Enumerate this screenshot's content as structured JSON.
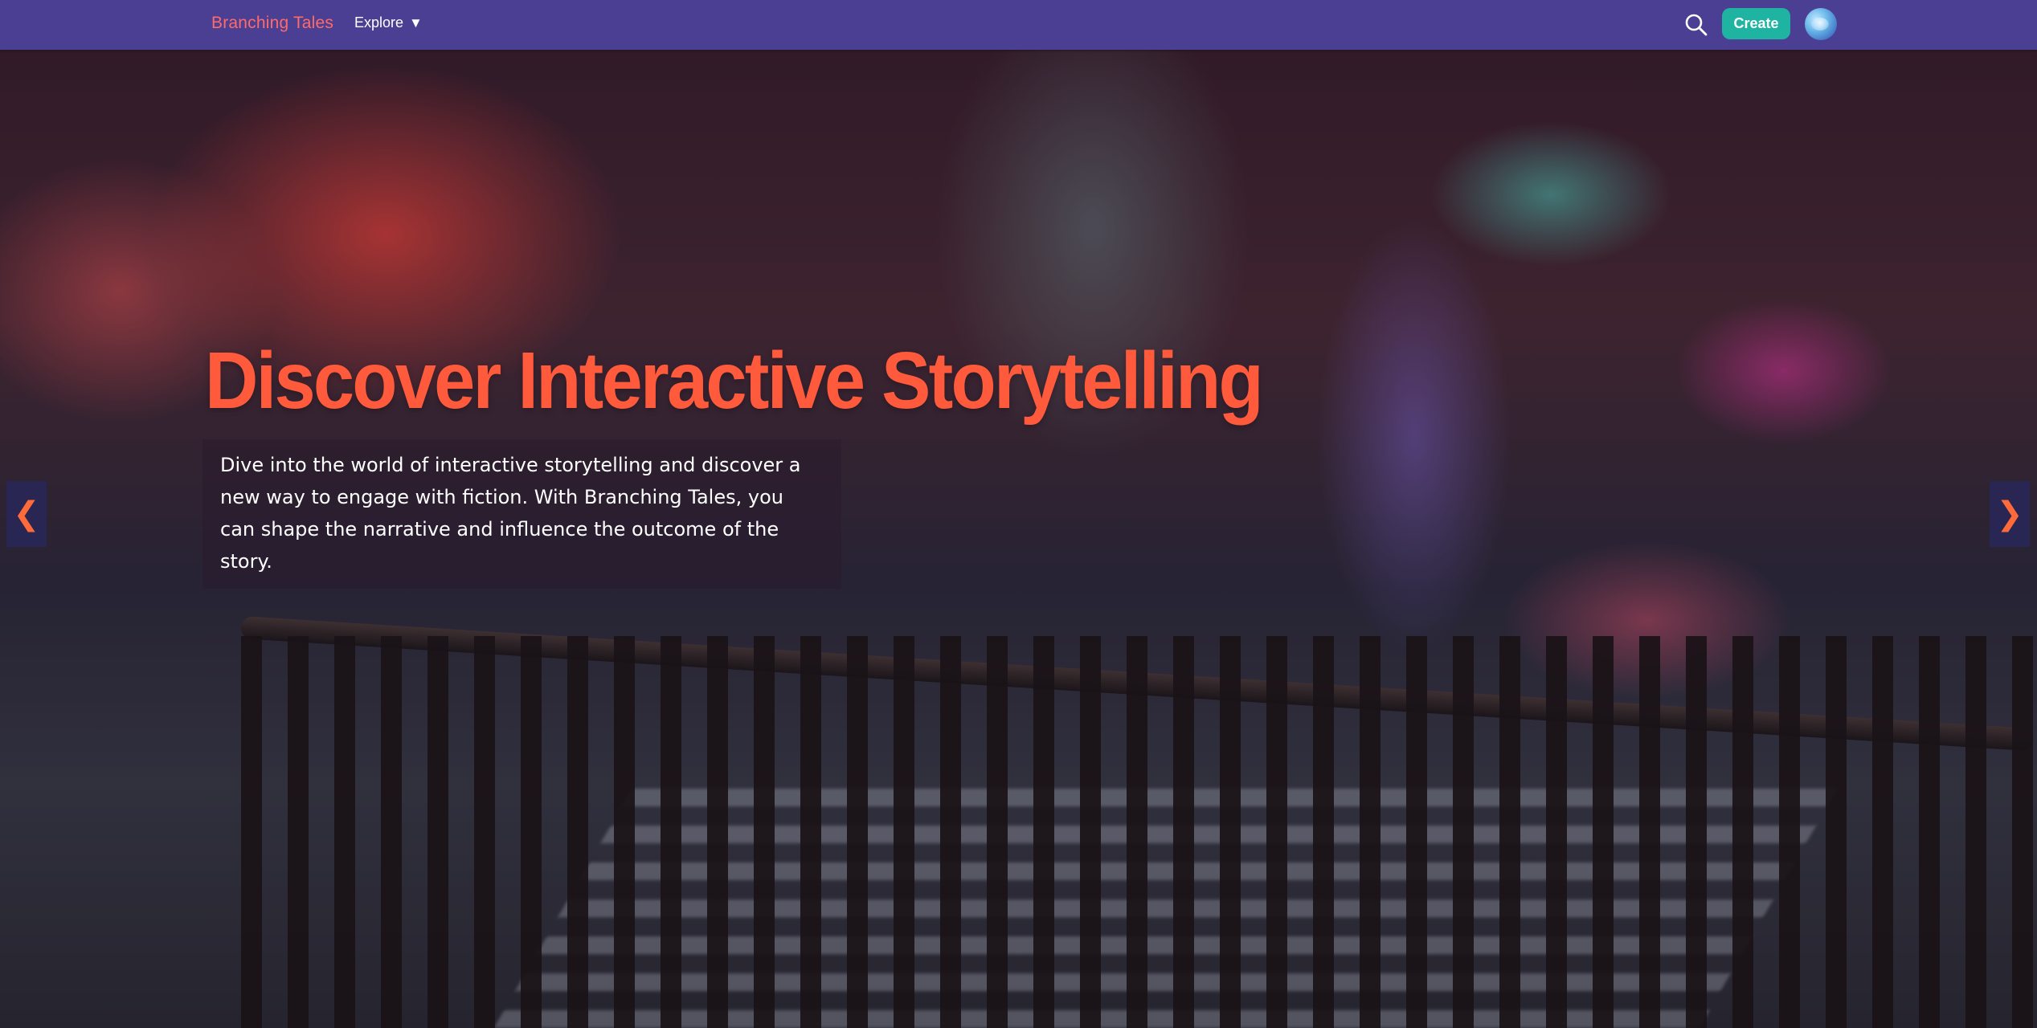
{
  "navbar": {
    "brand": "Branching Tales",
    "explore_label": "Explore",
    "explore_caret": "▼",
    "search_icon": "search-icon",
    "create_label": "Create",
    "avatar": "globe-avatar"
  },
  "hero": {
    "title": "Discover Interactive Storytelling",
    "description": "Dive into the world of interactive storytelling and discover a new way to engage with fiction. With Branching Tales, you can shape the narrative and influence the outcome of the story.",
    "prev_arrow": "❮",
    "next_arrow": "❯"
  },
  "colors": {
    "navbar_bg": "#4a3f93",
    "brand": "#ff6a6a",
    "create_button": "#1fb3a2",
    "hero_title": "#ff5a3c",
    "carousel_arrow": "#ff6a3a"
  }
}
